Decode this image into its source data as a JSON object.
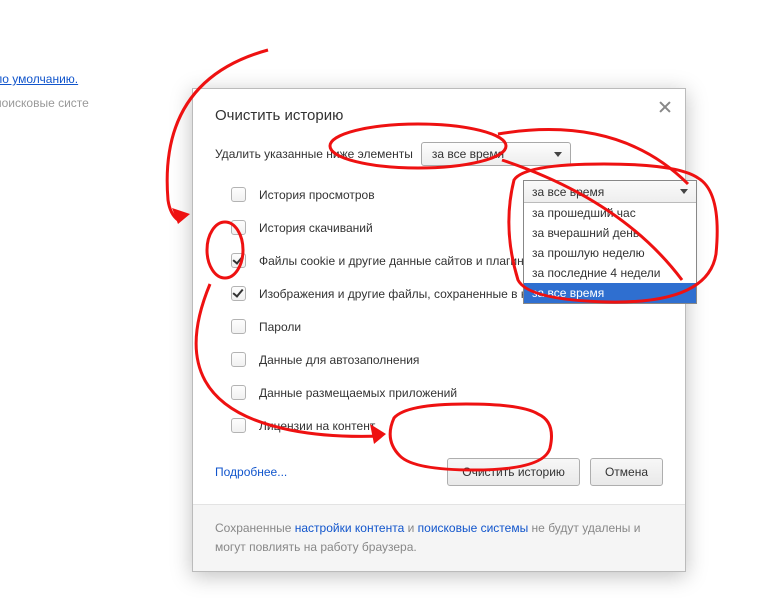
{
  "background": {
    "link1": "стему по умолчанию.",
    "link2": "роить поисковые систе"
  },
  "dialog": {
    "title": "Очистить историю",
    "delete_label": "Удалить указанные ниже элементы",
    "select_value": "за все время",
    "options": [
      {
        "label": "История просмотров",
        "checked": false
      },
      {
        "label": "История скачиваний",
        "checked": false
      },
      {
        "label": "Файлы cookie и другие данные сайтов и плагинов",
        "checked": true
      },
      {
        "label": "Изображения и другие файлы, сохраненные в кеше",
        "checked": true
      },
      {
        "label": "Пароли",
        "checked": false
      },
      {
        "label": "Данные для автозаполнения",
        "checked": false
      },
      {
        "label": "Данные размещаемых приложений",
        "checked": false
      },
      {
        "label": "Лицензии на контент",
        "checked": false
      }
    ],
    "more_link": "Подробнее...",
    "clear_button": "Очистить историю",
    "cancel_button": "Отмена",
    "footer_prefix": "Сохраненные ",
    "footer_link1": "настройки контента",
    "footer_mid": " и ",
    "footer_link2": "поисковые системы",
    "footer_suffix": " не будут удалены и могут повлиять на работу браузера."
  },
  "dropdown": {
    "selected": "за все время",
    "items": [
      "за прошедший час",
      "за вчерашний день",
      "за прошлую неделю",
      "за последние 4 недели",
      "за все время"
    ]
  }
}
